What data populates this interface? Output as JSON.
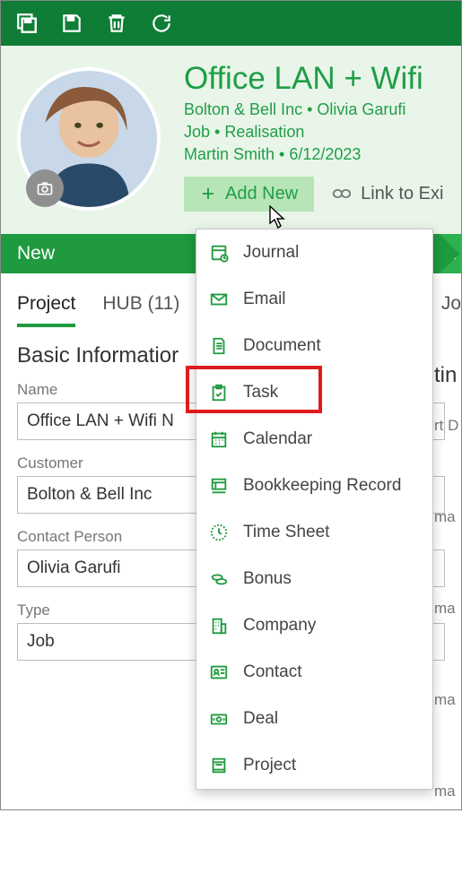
{
  "header": {
    "title": "Office LAN + Wifi",
    "meta1": "Bolton & Bell Inc  •  Olivia Garufi",
    "meta2": "Job  •  Realisation",
    "meta3": "Martin Smith  •  6/12/2023",
    "addNew": "Add New",
    "linkTo": "Link to Exi"
  },
  "status": {
    "left": "New",
    "right": "A"
  },
  "tabs": {
    "project": "Project",
    "hub": "HUB (11)",
    "right": "Jo"
  },
  "section": {
    "title": "Basic Informatior",
    "rightTitle": "tin"
  },
  "fields": {
    "nameLabel": "Name",
    "nameValue": "Office LAN + Wifi N",
    "customerLabel": "Customer",
    "customerValue": "Bolton & Bell Inc",
    "contactLabel": "Contact Person",
    "contactValue": "Olivia Garufi",
    "typeLabel": "Type",
    "typeValue": "Job",
    "rightLabel1": "rt D",
    "rightVal": "ma"
  },
  "dropdown": {
    "items": [
      "Journal",
      "Email",
      "Document",
      "Task",
      "Calendar",
      "Bookkeeping Record",
      "Time Sheet",
      "Bonus",
      "Company",
      "Contact",
      "Deal",
      "Project"
    ]
  }
}
